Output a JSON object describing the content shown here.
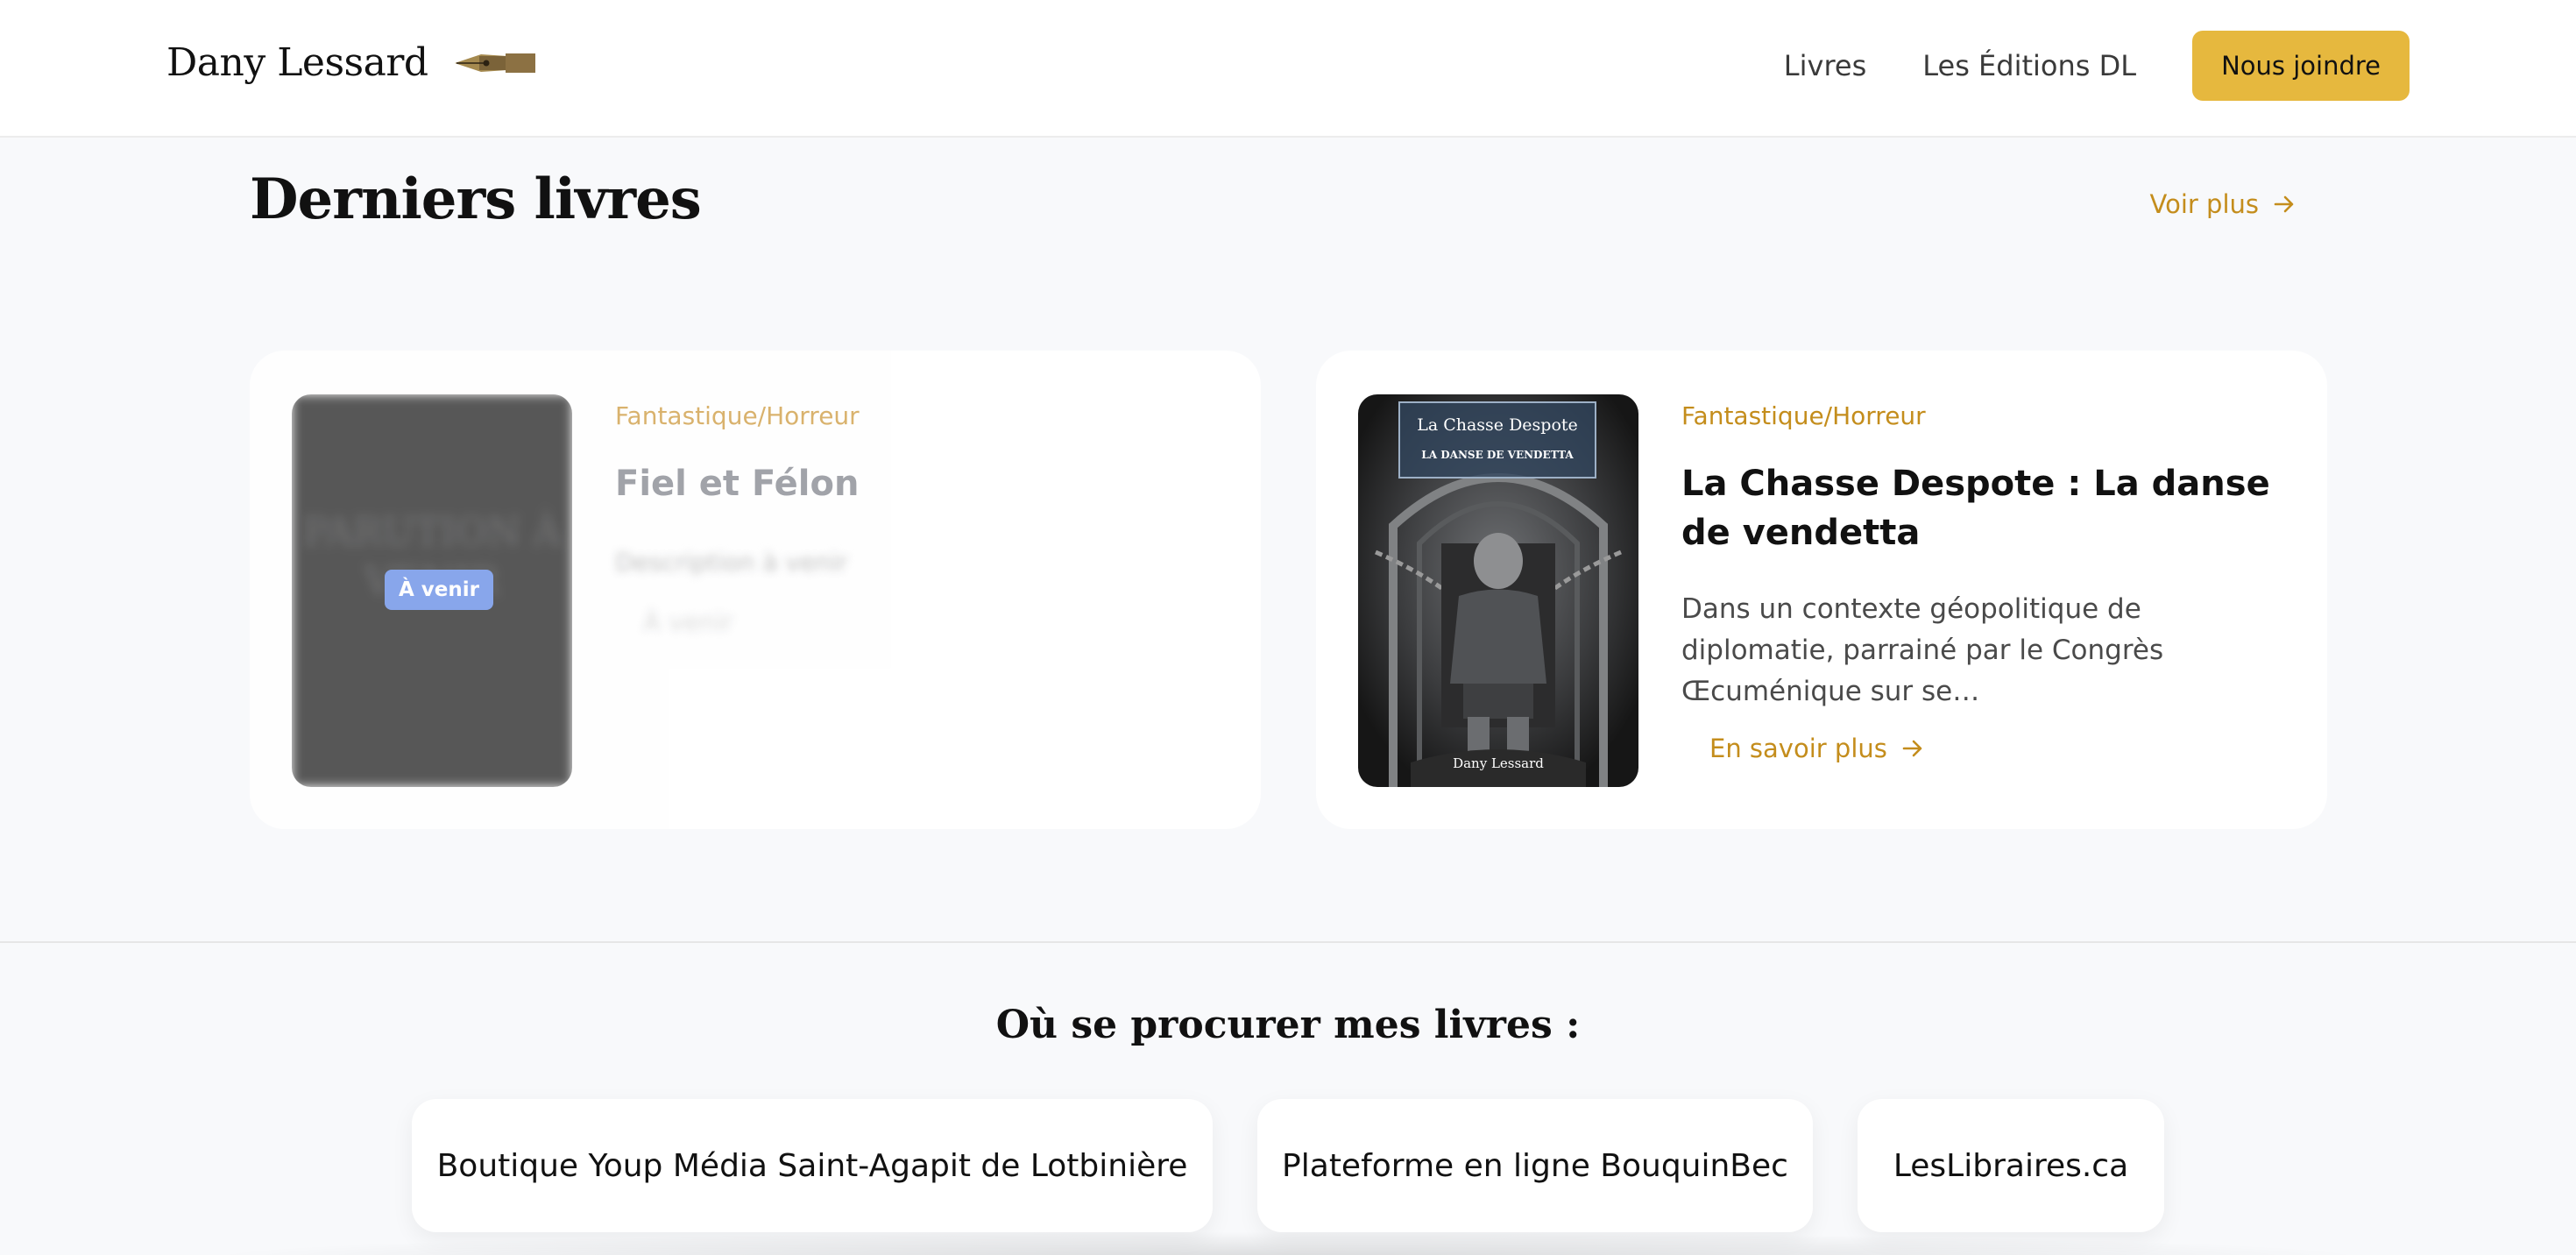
{
  "header": {
    "brand_name": "Dany Lessard",
    "brand_icon": "fountain-pen-icon",
    "nav": [
      "Livres",
      "Les Éditions DL"
    ],
    "cta_label": "Nous joindre"
  },
  "latest": {
    "title": "Derniers livres",
    "see_more": "Voir plus",
    "books": [
      {
        "genre": "Fantastique/Horreur",
        "title": "Fiel et Félon",
        "description": "Description à venir",
        "badge": "À venir",
        "placeholder_cover_text": "PARUTION À VENIR",
        "action": "À venir"
      },
      {
        "genre": "Fantastique/Horreur",
        "title": "La Chasse Despote : La danse de vendetta",
        "description": "Dans un contexte géopolitique de diplomatie, parrainé par le Congrès Œcuménique sur se…",
        "action": "En savoir plus",
        "cover_series": "La Chasse Despote",
        "cover_subtitle": "LA DANSE DE VENDETTA",
        "cover_author": "Dany Lessard"
      }
    ]
  },
  "stores": {
    "title": "Où se procurer mes livres :",
    "items": [
      "Boutique Youp Média Saint-Agapit de Lotbinière",
      "Plateforme en ligne BouquinBec",
      "LesLibraires.ca"
    ]
  },
  "colors": {
    "accent": "#e6b83e",
    "link": "#c48d1c",
    "badge": "#7f9fea"
  }
}
